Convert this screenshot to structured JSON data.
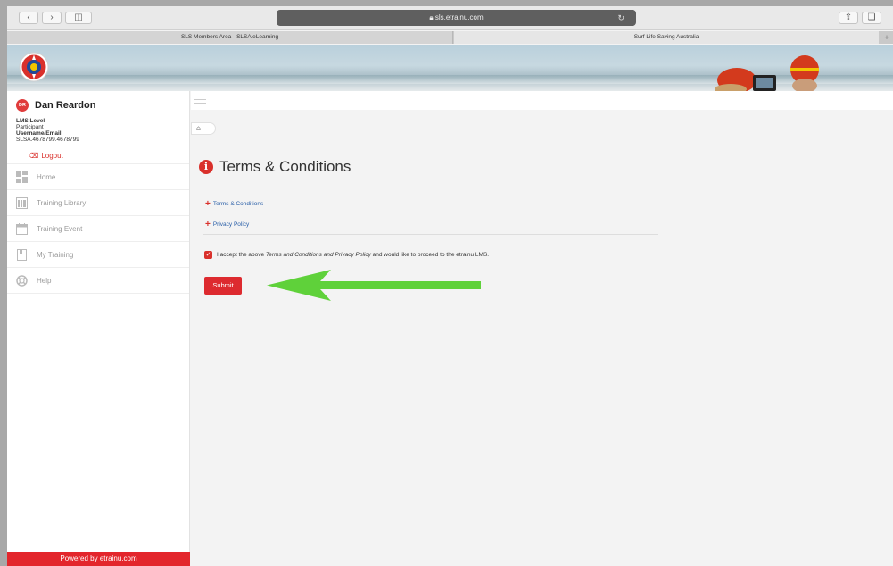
{
  "browser": {
    "url": "sls.etrainu.com",
    "tabs": [
      {
        "label": "SLS Members Area - SLSA eLearning"
      },
      {
        "label": "Surf Life Saving Australia"
      }
    ],
    "add_tab_label": "+"
  },
  "user": {
    "initials": "DR",
    "name": "Dan Reardon",
    "lms_level_label": "LMS Level",
    "lms_level": "Participant",
    "username_label": "Username/Email",
    "username": "SLSA.4678799.4678799",
    "logout_label": "Logout"
  },
  "sidebar": {
    "items": [
      {
        "label": "Home",
        "icon": "dashboard-icon"
      },
      {
        "label": "Training Library",
        "icon": "library-icon"
      },
      {
        "label": "Training Event",
        "icon": "calendar-icon"
      },
      {
        "label": "My Training",
        "icon": "bookmark-icon"
      },
      {
        "label": "Help",
        "icon": "lifebuoy-icon"
      }
    ],
    "powered_by": "Powered by etrainu.com"
  },
  "main": {
    "title": "Terms & Conditions",
    "links": [
      {
        "label": "Terms & Conditions"
      },
      {
        "label": "Privacy Policy"
      }
    ],
    "accept": {
      "prefix": "I accept the above ",
      "emphasis": "Terms and Conditions and Privacy Policy",
      "suffix": " and would like to proceed to the etrainu LMS.",
      "checked": true
    },
    "submit_label": "Submit"
  },
  "colors": {
    "brand_red": "#dd2a2f",
    "annotation_arrow": "#5fd13a"
  }
}
